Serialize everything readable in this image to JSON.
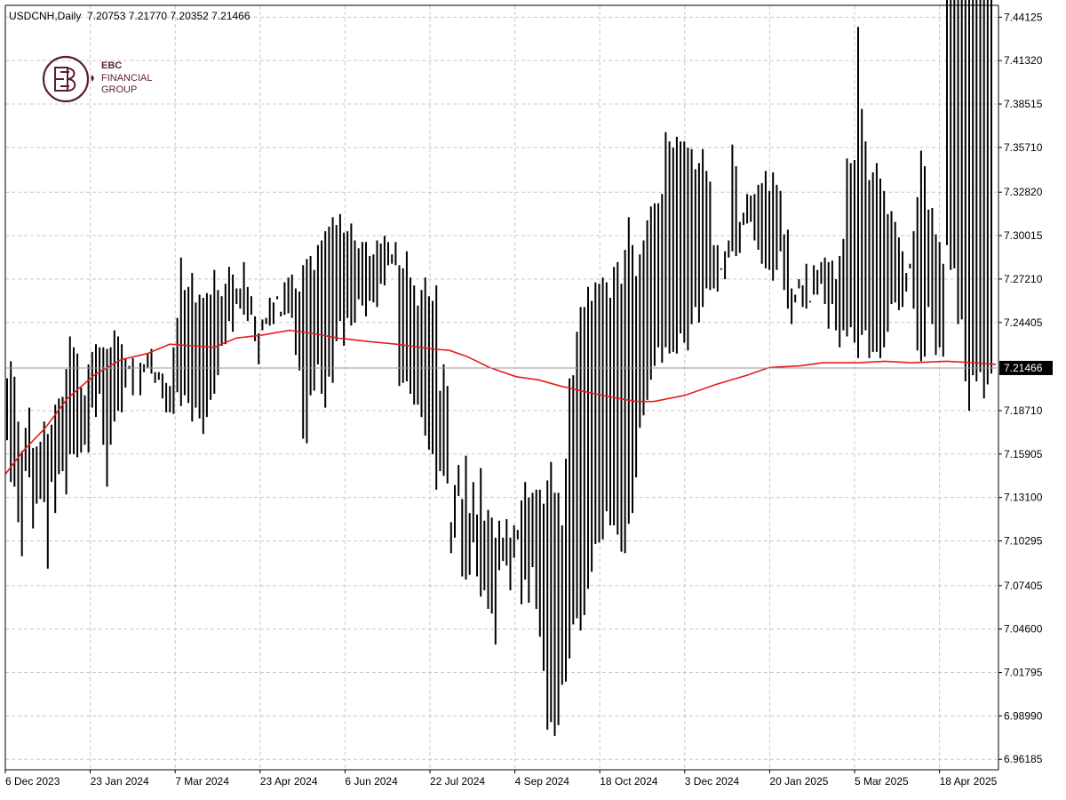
{
  "header": {
    "symbol": "USDCNH,Daily",
    "ohlc": "7.20753 7.21770 7.20352 7.21466"
  },
  "logo": {
    "line1": "EBC",
    "line2": "FINANCIAL",
    "line3": "GROUP",
    "color": "#5b1f2c"
  },
  "colors": {
    "bars": "#000000",
    "ma": "#e31e1e",
    "grid": "#c8c8c8",
    "price_tag_bg": "#000000",
    "price_tag_fg": "#ffffff"
  },
  "chart_data": {
    "type": "ohlc",
    "title": "USDCNH,Daily",
    "ylim": [
      6.9551,
      7.4489
    ],
    "grid": true,
    "y_ticks": [
      "7.44125",
      "7.41320",
      "7.38515",
      "7.35710",
      "7.32820",
      "7.30015",
      "7.27210",
      "7.24405",
      "7.21466",
      "7.18710",
      "7.15905",
      "7.13100",
      "7.10295",
      "7.07405",
      "7.04600",
      "7.01795",
      "6.98990",
      "6.96185"
    ],
    "x_ticks": [
      "6 Dec 2023",
      "23 Jan 2024",
      "7 Mar 2024",
      "23 Apr 2024",
      "6 Jun 2024",
      "22 Jul 2024",
      "4 Sep 2024",
      "18 Oct 2024",
      "3 Dec 2024",
      "20 Jan 2025",
      "5 Mar 2025",
      "18 Apr 2025"
    ],
    "current_price": "7.21466",
    "bar_lows": [
      7.168,
      7.141,
      7.138,
      7.115,
      7.093,
      7.148,
      7.144,
      7.111,
      7.127,
      7.13,
      7.128,
      7.085,
      7.141,
      7.121,
      7.146,
      7.148,
      7.133,
      7.159,
      7.159,
      7.157,
      7.16,
      7.165,
      7.16,
      7.189,
      7.183,
      7.198,
      7.165,
      7.138,
      7.165,
      7.18,
      7.187,
      7.186,
      7.202,
      7.214,
      7.197,
      7.212,
      7.197,
      7.217,
      7.224,
      7.227,
      7.212,
      7.207,
      7.195,
      7.186,
      7.186,
      7.185,
      7.199,
      7.19,
      7.197,
      7.192,
      7.18,
      7.189,
      7.182,
      7.172,
      7.183,
      7.194,
      7.198,
      7.21,
      7.229,
      7.23,
      7.245,
      7.238,
      7.256,
      7.253,
      7.249,
      7.245,
      7.249,
      7.248,
      7.237,
      7.239,
      7.243,
      7.26,
      7.257,
      7.261,
      7.248,
      7.249,
      7.25,
      7.247,
      7.223,
      7.213,
      7.169,
      7.166,
      7.197,
      7.2,
      7.217,
      7.198,
      7.189,
      7.209,
      7.205,
      7.232,
      7.245,
      7.229,
      7.247,
      7.242,
      7.244,
      7.259,
      7.255,
      7.248,
      7.258,
      7.257,
      7.254,
      7.269,
      7.268,
      7.281,
      7.288,
      7.281,
      7.281,
      7.279,
      7.29,
      7.273,
      7.268,
      7.255,
      7.265,
      7.273,
      7.261,
      7.258,
      7.268,
      7.2,
      7.217,
      7.203,
      7.095,
      7.139,
      7.152,
      7.13,
      7.158,
      7.121,
      7.141,
      7.12,
      7.15,
      7.116,
      7.123,
      7.118,
      7.105,
      7.116,
      7.09,
      7.087,
      7.071,
      7.092,
      7.104,
      7.062,
      7.078,
      7.063,
      7.086,
      7.059,
      7.041,
      7.019,
      6.981,
      6.986,
      6.977,
      6.984,
      7.01,
      7.012,
      7.027,
      7.049,
      7.053,
      7.045,
      7.055,
      7.072,
      7.083,
      7.101,
      7.102,
      7.104,
      7.122,
      7.113,
      7.113,
      7.107,
      7.096,
      7.095,
      7.114,
      7.121,
      7.144,
      7.176,
      7.184,
      7.194,
      7.207,
      7.216,
      7.228,
      7.218,
      7.228,
      7.224,
      7.225,
      7.224,
      7.237,
      7.231,
      7.226,
      7.243,
      7.254,
      7.244,
      7.254,
      7.266,
      7.265,
      7.266,
      7.264,
      7.278,
      7.272,
      7.286,
      7.29,
      7.287,
      7.289,
      7.307,
      7.308,
      7.309,
      7.327,
      7.333,
      7.334,
      7.342,
      7.329,
      7.341,
      7.333,
      7.329,
      7.265,
      7.253,
      7.243,
      7.257,
      7.266,
      7.254,
      7.282,
      7.258,
      7.281,
      7.278,
      7.269,
      7.256,
      7.24,
      7.256,
      7.239,
      7.228,
      7.239,
      7.235,
      7.241,
      7.231,
      7.221,
      7.236,
      7.239,
      7.221,
      7.225,
      7.225,
      7.221,
      7.228,
      7.238,
      7.256,
      7.257,
      7.252,
      7.254,
      7.264,
      7.282,
      7.303,
      7.325,
      7.355,
      7.345,
      7.317,
      7.318,
      7.301,
      7.296,
      7.282,
      7.294,
      7.278,
      7.279,
      7.243,
      7.246,
      7.206,
      7.187,
      7.21,
      7.206,
      7.212,
      7.195,
      7.204,
      7.211
    ],
    "bar_highs": [
      7.208,
      7.219,
      7.209,
      7.18,
      7.161,
      7.176,
      7.189,
      7.163,
      7.164,
      7.167,
      7.18,
      7.172,
      7.178,
      7.191,
      7.195,
      7.196,
      7.214,
      7.235,
      7.228,
      7.224,
      7.202,
      7.197,
      7.217,
      7.225,
      7.23,
      7.228,
      7.228,
      7.227,
      7.228,
      7.239,
      7.235,
      7.23,
      7.221,
      7.216,
      7.221,
      7.212,
      7.218,
      7.212,
      7.215,
      7.211,
      7.205,
      7.212,
      7.211,
      7.205,
      7.203,
      7.228,
      7.247,
      7.286,
      7.265,
      7.267,
      7.276,
      7.257,
      7.262,
      7.26,
      7.263,
      7.262,
      7.278,
      7.265,
      7.261,
      7.269,
      7.28,
      7.275,
      7.266,
      7.266,
      7.283,
      7.267,
      7.261,
      7.232,
      7.217,
      7.246,
      7.247,
      7.242,
      7.243,
      7.259,
      7.251,
      7.27,
      7.273,
      7.275,
      7.266,
      7.264,
      7.281,
      7.285,
      7.287,
      7.278,
      7.294,
      7.297,
      7.303,
      7.306,
      7.312,
      7.307,
      7.314,
      7.302,
      7.303,
      7.308,
      7.297,
      7.292,
      7.296,
      7.296,
      7.287,
      7.288,
      7.297,
      7.295,
      7.3,
      7.296,
      7.282,
      7.296,
      7.203,
      7.205,
      7.206,
      7.198,
      7.191,
      7.191,
      7.183,
      7.171,
      7.162,
      7.159,
      7.136,
      7.148,
      7.145,
      7.14,
      7.115,
      7.105,
      7.132,
      7.08,
      7.078,
      7.081,
      7.102,
      7.08,
      7.067,
      7.071,
      7.059,
      7.056,
      7.036,
      7.084,
      7.105,
      7.117,
      7.105,
      7.113,
      7.11,
      7.129,
      7.141,
      7.131,
      7.134,
      7.136,
      7.136,
      7.127,
      7.142,
      7.154,
      7.134,
      7.134,
      7.113,
      7.156,
      7.208,
      7.21,
      7.238,
      7.254,
      7.254,
      7.267,
      7.258,
      7.27,
      7.269,
      7.273,
      7.27,
      7.26,
      7.28,
      7.283,
      7.269,
      7.291,
      7.312,
      7.294,
      7.274,
      7.288,
      7.297,
      7.31,
      7.319,
      7.321,
      7.321,
      7.327,
      7.367,
      7.361,
      7.357,
      7.364,
      7.361,
      7.361,
      7.357,
      7.356,
      7.343,
      7.347,
      7.356,
      7.342,
      7.335,
      7.294,
      7.294,
      7.279,
      7.29,
      7.297,
      7.359,
      7.345,
      7.309,
      7.315,
      7.327,
      7.326,
      7.297,
      7.291,
      7.282,
      7.279,
      7.278,
      7.271,
      7.278,
      7.29,
      7.301,
      7.304,
      7.266,
      7.262,
      7.272,
      7.268,
      7.253,
      7.257,
      7.262,
      7.262,
      7.283,
      7.286,
      7.283,
      7.284,
      7.272,
      7.287,
      7.298,
      7.35,
      7.347,
      7.349,
      7.435,
      7.382,
      7.361,
      7.336,
      7.341,
      7.347,
      7.337,
      7.329,
      7.314,
      7.316,
      7.309,
      7.299,
      7.29,
      7.276,
      7.279,
      7.253,
      7.226,
      7.219,
      7.222,
      7.254,
      7.243,
      7.223,
      7.228,
      7.222
    ],
    "ma": [
      [
        0,
        7.146
      ],
      [
        20,
        7.161
      ],
      [
        45,
        7.176
      ],
      [
        70,
        7.195
      ],
      [
        100,
        7.21
      ],
      [
        130,
        7.22
      ],
      [
        160,
        7.224
      ],
      [
        185,
        7.23
      ],
      [
        210,
        7.229
      ],
      [
        235,
        7.228
      ],
      [
        260,
        7.234
      ],
      [
        290,
        7.236
      ],
      [
        320,
        7.239
      ],
      [
        345,
        7.237
      ],
      [
        375,
        7.234
      ],
      [
        405,
        7.232
      ],
      [
        440,
        7.23
      ],
      [
        480,
        7.227
      ],
      [
        500,
        7.226
      ],
      [
        520,
        7.222
      ],
      [
        545,
        7.215
      ],
      [
        575,
        7.209
      ],
      [
        600,
        7.207
      ],
      [
        625,
        7.203
      ],
      [
        655,
        7.199
      ],
      [
        680,
        7.196
      ],
      [
        710,
        7.193
      ],
      [
        730,
        7.193
      ],
      [
        765,
        7.197
      ],
      [
        800,
        7.204
      ],
      [
        835,
        7.21
      ],
      [
        860,
        7.215
      ],
      [
        895,
        7.216
      ],
      [
        920,
        7.218
      ],
      [
        960,
        7.218
      ],
      [
        990,
        7.219
      ],
      [
        1020,
        7.218
      ],
      [
        1060,
        7.219
      ],
      [
        1090,
        7.218
      ],
      [
        1115,
        7.217
      ]
    ]
  }
}
